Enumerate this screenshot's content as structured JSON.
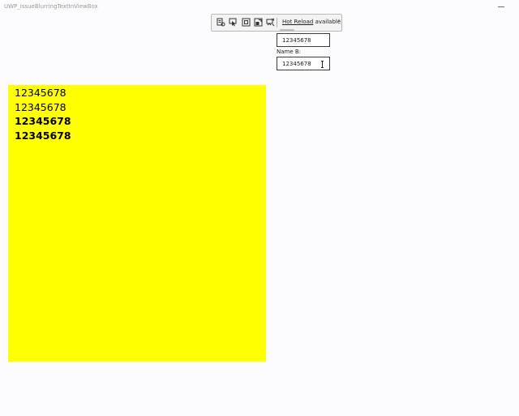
{
  "window": {
    "title": "UWP_IssueBlurringTextInViewBox"
  },
  "devbar": {
    "tools": [
      {
        "icon": "live-visual-tree-icon"
      },
      {
        "icon": "select-element-icon"
      },
      {
        "icon": "display-layout-adorners-icon"
      },
      {
        "icon": "track-focus-icon"
      },
      {
        "icon": "binding-failures-icon"
      }
    ],
    "hot_reload_link": "Hot Reload",
    "hot_reload_status": " available",
    "collapse_glyph": "‹"
  },
  "form": {
    "field_a_value": "12345678",
    "label_b": "Name B:",
    "field_b_value": "12345678"
  },
  "panel": {
    "line_1": "12345678",
    "line_2": "12345678",
    "line_3": "12345678",
    "line_4": "12345678",
    "background": "#ffff00"
  }
}
